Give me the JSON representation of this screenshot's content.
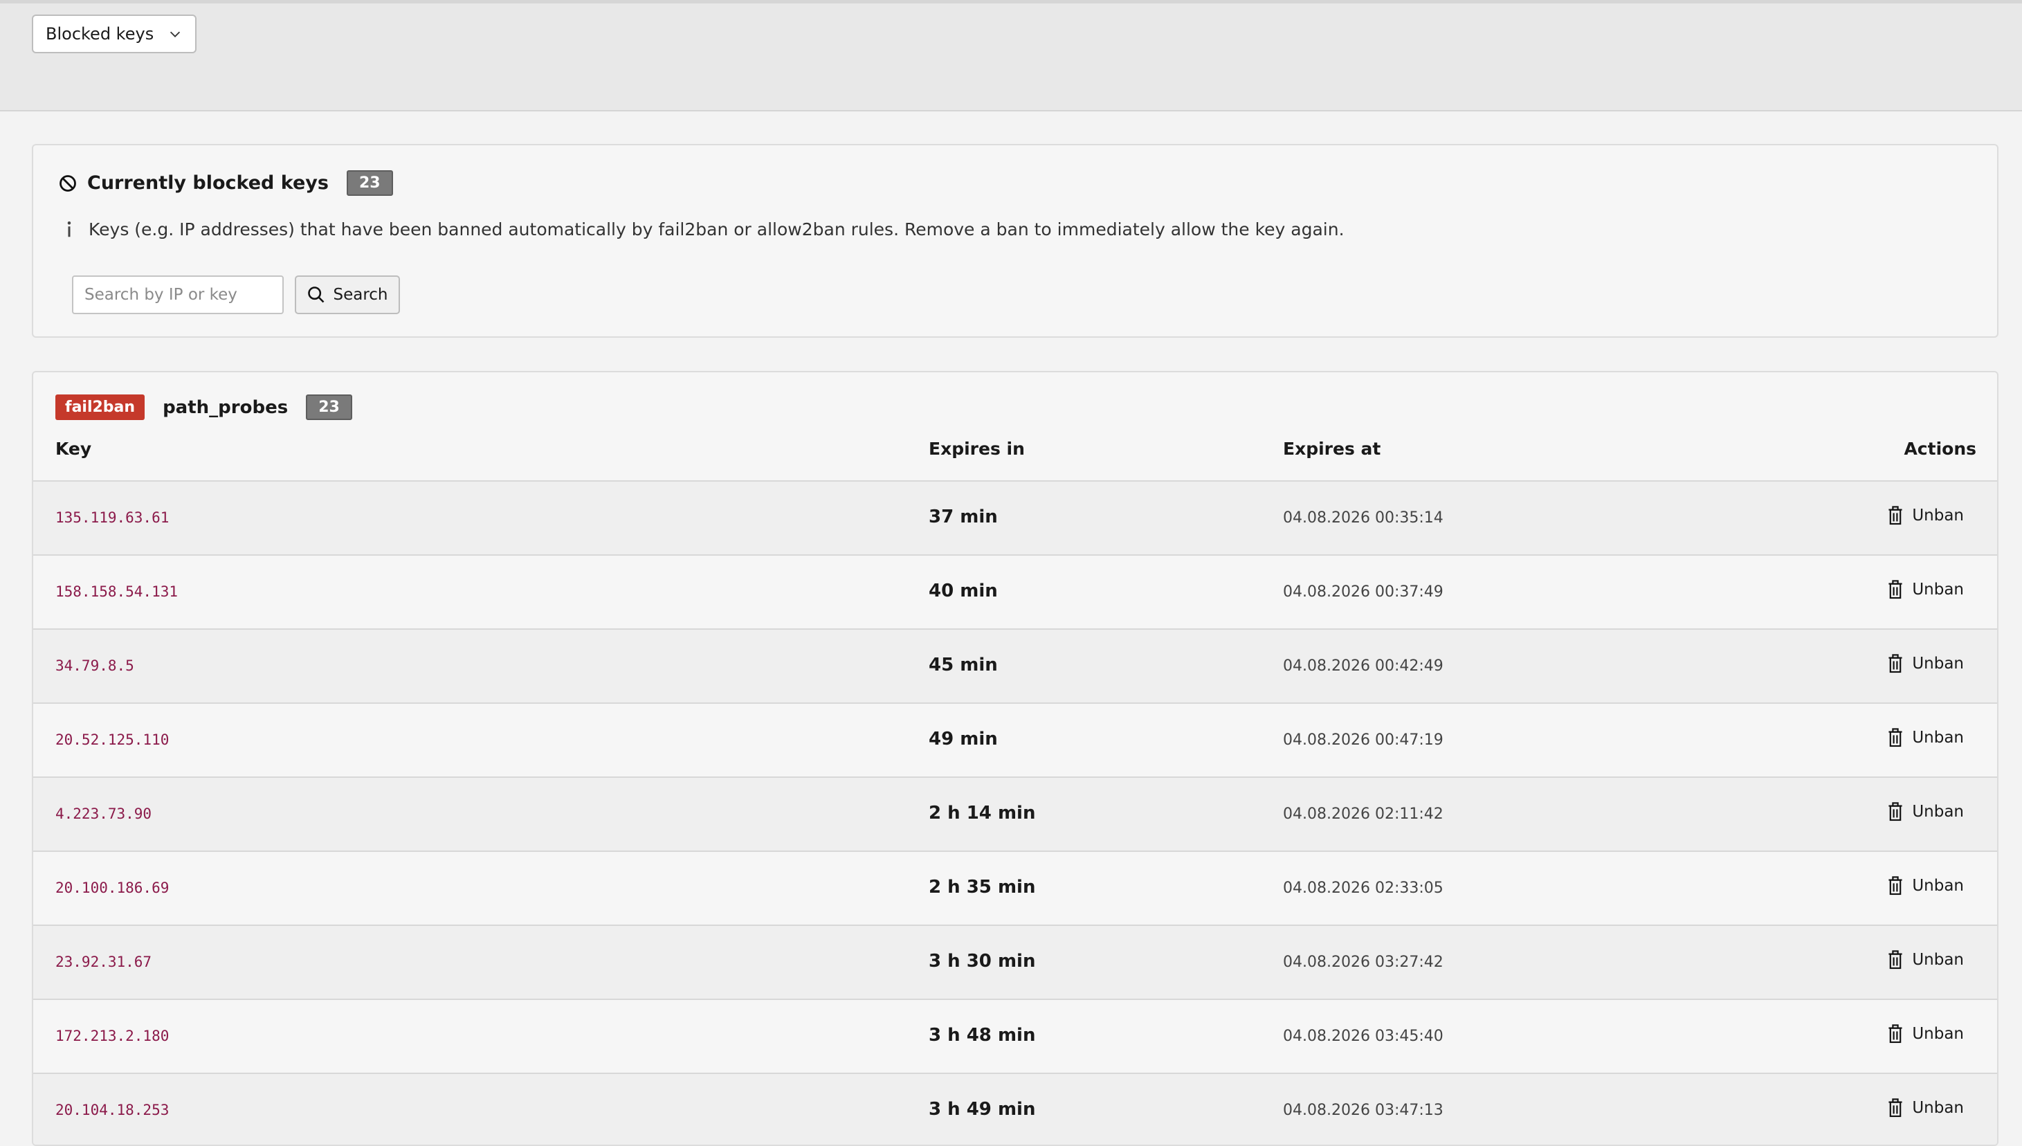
{
  "toolbar": {
    "dropdown_label": "Blocked keys"
  },
  "panel": {
    "title": "Currently blocked keys",
    "count": "23",
    "info": "Keys (e.g. IP addresses) that have been banned automatically by fail2ban or allow2ban rules. Remove a ban to immediately allow the key again.",
    "search_placeholder": "Search by IP or key",
    "search_button": "Search"
  },
  "group": {
    "tag": "fail2ban",
    "name": "path_probes",
    "count": "23",
    "columns": {
      "key": "Key",
      "expires_in": "Expires in",
      "expires_at": "Expires at",
      "actions": "Actions"
    },
    "rows": [
      {
        "key": "135.119.63.61",
        "expires_in": "37 min",
        "expires_at": "04.08.2026 00:35:14",
        "action": "Unban"
      },
      {
        "key": "158.158.54.131",
        "expires_in": "40 min",
        "expires_at": "04.08.2026 00:37:49",
        "action": "Unban"
      },
      {
        "key": "34.79.8.5",
        "expires_in": "45 min",
        "expires_at": "04.08.2026 00:42:49",
        "action": "Unban"
      },
      {
        "key": "20.52.125.110",
        "expires_in": "49 min",
        "expires_at": "04.08.2026 00:47:19",
        "action": "Unban"
      },
      {
        "key": "4.223.73.90",
        "expires_in": "2 h 14 min",
        "expires_at": "04.08.2026 02:11:42",
        "action": "Unban"
      },
      {
        "key": "20.100.186.69",
        "expires_in": "2 h 35 min",
        "expires_at": "04.08.2026 02:33:05",
        "action": "Unban"
      },
      {
        "key": "23.92.31.67",
        "expires_in": "3 h 30 min",
        "expires_at": "04.08.2026 03:27:42",
        "action": "Unban"
      },
      {
        "key": "172.213.2.180",
        "expires_in": "3 h 48 min",
        "expires_at": "04.08.2026 03:45:40",
        "action": "Unban"
      },
      {
        "key": "20.104.18.253",
        "expires_in": "3 h 49 min",
        "expires_at": "04.08.2026 03:47:13",
        "action": "Unban"
      }
    ]
  },
  "colors": {
    "tag_red": "#c5392b",
    "key_text": "#8b1a4a",
    "badge_gray": "#7a7a7a"
  },
  "icons": {
    "dropdown": "chevron-down-icon",
    "title": "ban-icon",
    "info": "info-icon",
    "search": "search-icon",
    "unban": "trash-icon"
  }
}
